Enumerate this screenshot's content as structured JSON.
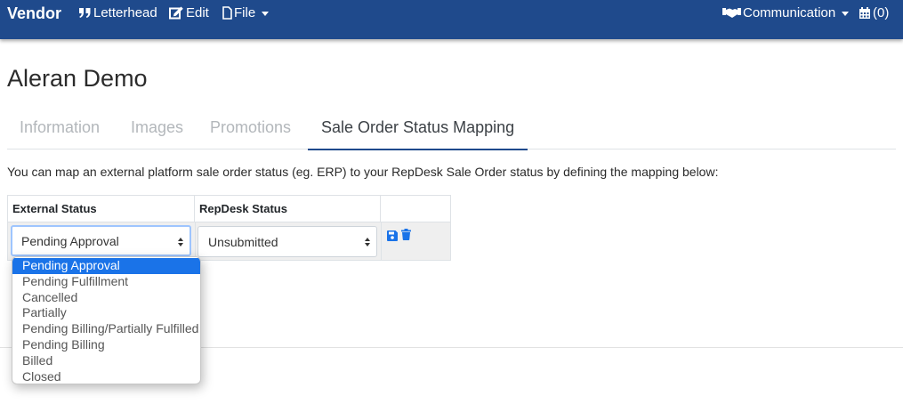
{
  "navbar": {
    "brand": "Vendor",
    "letterhead": "Letterhead",
    "edit": "Edit",
    "file": "File",
    "communication": "Communication",
    "cart": "(0)",
    "color": "#1f4a8c"
  },
  "page": {
    "title": "Aleran Demo",
    "tabs": [
      {
        "label": "Information",
        "active": false
      },
      {
        "label": "Images",
        "active": false
      },
      {
        "label": "Promotions",
        "active": false
      },
      {
        "label": "Sale Order Status Mapping",
        "active": true
      }
    ],
    "description": "You can map an external platform sale order status (eg. ERP) to your RepDesk Sale Order status by defining the mapping below:"
  },
  "table": {
    "headers": [
      "External Status",
      "RepDesk Status",
      ""
    ],
    "row": {
      "external_status": "Pending Approval",
      "repdesk_status": "Unsubmitted",
      "actions": [
        "save-icon",
        "trash-icon"
      ]
    }
  },
  "dropdown": {
    "selected_index": 0,
    "options": [
      "Pending Approval",
      "Pending Fulfillment",
      "Cancelled",
      "Partially",
      "Pending Billing/Partially Fulfilled",
      "Pending Billing",
      "Billed",
      "Closed"
    ],
    "highlight_color": "#1a73e8"
  }
}
